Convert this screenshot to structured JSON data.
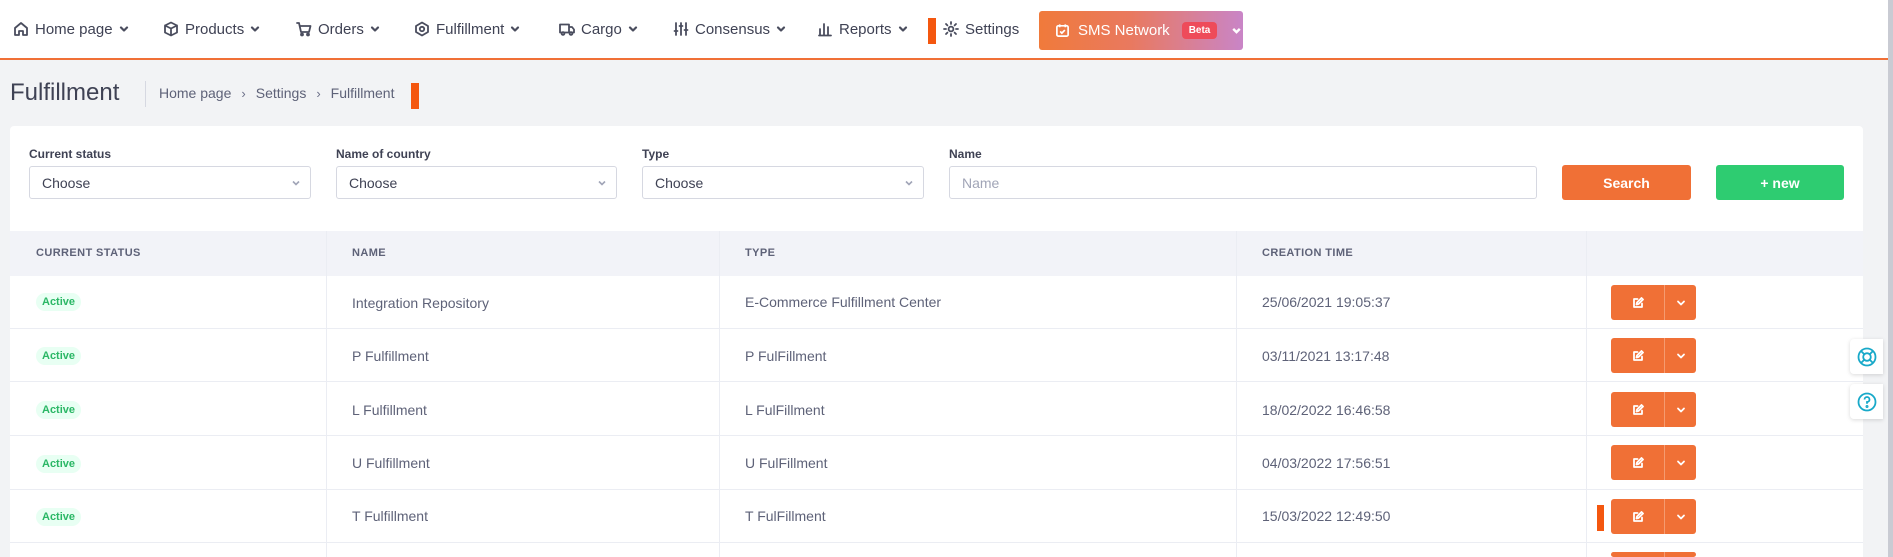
{
  "nav": {
    "items": [
      {
        "label": "Home page",
        "icon": "home-icon"
      },
      {
        "label": "Products",
        "icon": "box-icon"
      },
      {
        "label": "Orders",
        "icon": "cart-icon"
      },
      {
        "label": "Fulfillment",
        "icon": "hexagon-icon"
      },
      {
        "label": "Cargo",
        "icon": "truck-icon"
      },
      {
        "label": "Consensus",
        "icon": "sliders-icon"
      },
      {
        "label": "Reports",
        "icon": "bar-chart-icon"
      },
      {
        "label": "Settings",
        "icon": "gear-icon"
      }
    ],
    "sms": {
      "label": "SMS Network",
      "badge": "Beta"
    }
  },
  "page": {
    "title": "Fulfillment",
    "breadcrumb": [
      "Home page",
      "Settings",
      "Fulfillment"
    ]
  },
  "filters": {
    "status": {
      "label": "Current status",
      "value": "Choose"
    },
    "country": {
      "label": "Name of country",
      "value": "Choose"
    },
    "type": {
      "label": "Type",
      "value": "Choose"
    },
    "name": {
      "label": "Name",
      "placeholder": "Name"
    },
    "search_label": "Search",
    "new_label": "+ new"
  },
  "table": {
    "headers": [
      "CURRENT STATUS",
      "NAME",
      "TYPE",
      "CREATION TIME"
    ],
    "rows": [
      {
        "status": "Active",
        "name": "Integration Repository",
        "type": "E-Commerce Fulfillment Center",
        "created": "25/06/2021 19:05:37"
      },
      {
        "status": "Active",
        "name": "P Fulfillment",
        "type": "P FulFillment",
        "created": "03/11/2021 13:17:48"
      },
      {
        "status": "Active",
        "name": "L Fulfillment",
        "type": "L FulFillment",
        "created": "18/02/2022 16:46:58"
      },
      {
        "status": "Active",
        "name": "U Fulfillment",
        "type": "U FulFillment",
        "created": "04/03/2022 17:56:51"
      },
      {
        "status": "Active",
        "name": "T Fulfillment",
        "type": "T FulFillment",
        "created": "15/03/2022 12:49:50"
      }
    ]
  },
  "colors": {
    "accent": "#f07036",
    "success": "#2ecc71",
    "marker": "#f4570f"
  }
}
